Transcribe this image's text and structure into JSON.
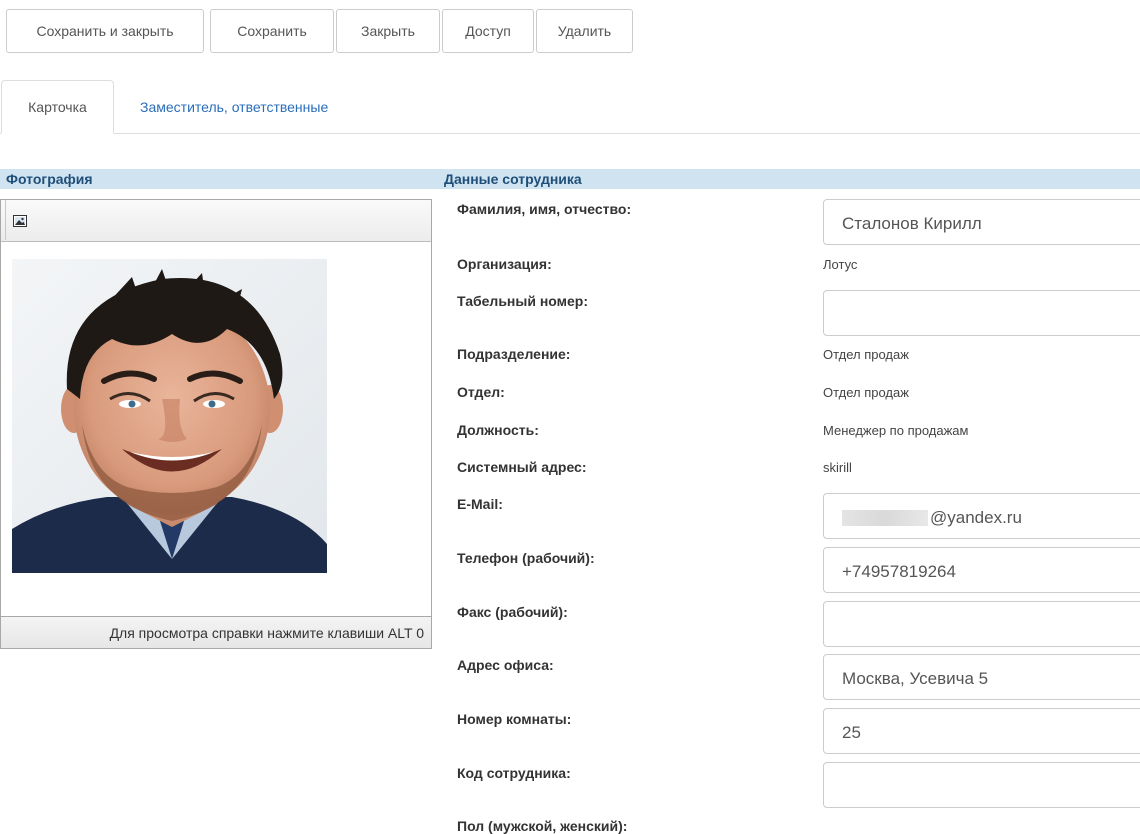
{
  "toolbar": {
    "buttons": [
      {
        "label": "Сохранить и закрыть"
      },
      {
        "label": "Сохранить"
      },
      {
        "label": "Закрыть"
      },
      {
        "label": "Доступ"
      },
      {
        "label": "Удалить"
      }
    ]
  },
  "tabs": [
    {
      "label": "Карточка",
      "active": true
    },
    {
      "label": "Заместитель, ответственные",
      "active": false
    }
  ],
  "photo_section": {
    "title": "Фотография",
    "help_text": "Для просмотра справки нажмите клавиши ALT 0"
  },
  "employee_section": {
    "title": "Данные сотрудника",
    "fields": {
      "full_name": {
        "label": "Фамилия, имя, отчество:",
        "value": "Сталонов Кирилл"
      },
      "organization": {
        "label": "Организация:",
        "value": "Лотус"
      },
      "personnel_number": {
        "label": "Табельный номер:",
        "value": ""
      },
      "division": {
        "label": "Подразделение:",
        "value": "Отдел продаж"
      },
      "department": {
        "label": "Отдел:",
        "value": "Отдел продаж"
      },
      "position": {
        "label": "Должность:",
        "value": "Менеджер по продажам"
      },
      "system_address": {
        "label": "Системный адрес:",
        "value": "skirill"
      },
      "email": {
        "label": "E-Mail:",
        "value": "@yandex.ru"
      },
      "work_phone": {
        "label": "Телефон (рабочий):",
        "value": "+74957819264"
      },
      "work_fax": {
        "label": "Факс (рабочий):",
        "value": ""
      },
      "office_address": {
        "label": "Адрес офиса:",
        "value": "Москва, Усевича 5"
      },
      "room_number": {
        "label": "Номер комнаты:",
        "value": "25"
      },
      "employee_code": {
        "label": "Код сотрудника:",
        "value": ""
      },
      "gender": {
        "label": "Пол (мужской, женский):",
        "value": ""
      }
    }
  },
  "colors": {
    "section_bar": "#cfe3f1",
    "section_title": "#1f4e79",
    "link": "#2a6ebb"
  }
}
